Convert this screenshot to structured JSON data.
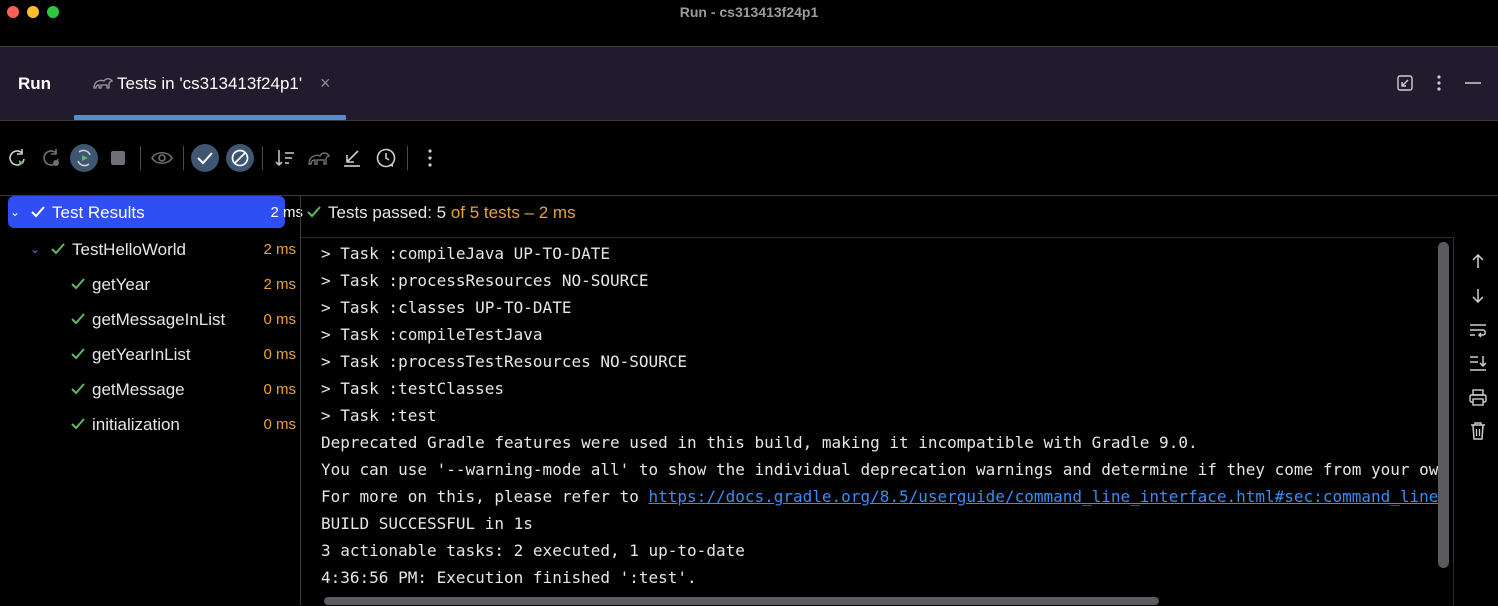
{
  "window": {
    "title": "Run - cs313413f24p1"
  },
  "tabbar": {
    "run_label": "Run",
    "tab_label": "Tests in 'cs313413f24p1'",
    "tab_close": "×",
    "right_icons": [
      "restore-layout-icon",
      "more-options-icon",
      "minimize-icon"
    ]
  },
  "toolbar": {
    "buttons": [
      "rerun-icon",
      "rerun-failed-icon",
      "toggle-auto-test-icon",
      "stop-icon",
      "show-ignored-icon",
      "show-passed-icon",
      "show-ignored-filter-icon",
      "sort-icon",
      "import-tests-icon",
      "export-icon",
      "history-icon",
      "more-icon"
    ],
    "active": [
      "toggle-auto-test-icon",
      "show-passed-icon",
      "show-ignored-filter-icon"
    ]
  },
  "tree": {
    "items": [
      {
        "name": "Test Results",
        "time": "2 ms",
        "level": 0,
        "expanded": true,
        "selected": true
      },
      {
        "name": "TestHelloWorld",
        "time": "2 ms",
        "level": 1,
        "expanded": true,
        "selected": false
      },
      {
        "name": "getYear",
        "time": "2 ms",
        "level": 2
      },
      {
        "name": "getMessageInList",
        "time": "0 ms",
        "level": 2
      },
      {
        "name": "getYearInList",
        "time": "0 ms",
        "level": 2
      },
      {
        "name": "getMessage",
        "time": "0 ms",
        "level": 2
      },
      {
        "name": "initialization",
        "time": "0 ms",
        "level": 2
      }
    ]
  },
  "status": {
    "passed": "Tests passed: 5",
    "rest": " of 5 tests – 2 ms"
  },
  "console": {
    "lines": [
      "> Task :compileJava UP-TO-DATE",
      "> Task :processResources NO-SOURCE",
      "> Task :classes UP-TO-DATE",
      "> Task :compileTestJava",
      "> Task :processTestResources NO-SOURCE",
      "> Task :testClasses",
      "> Task :test",
      "Deprecated Gradle features were used in this build, making it incompatible with Gradle 9.0.",
      "You can use '--warning-mode all' to show the individual deprecation warnings and determine if they come from your ow",
      "For more on this, please refer to ",
      "BUILD SUCCESSFUL in 1s",
      "3 actionable tasks: 2 executed, 1 up-to-date",
      "4:36:56 PM: Execution finished ':test'."
    ],
    "link": "https://docs.gradle.org/8.5/userguide/command_line_interface.html#sec:command_line"
  },
  "right_tools": [
    "scroll-up-icon",
    "scroll-down-icon",
    "soft-wrap-icon",
    "scroll-to-end-icon",
    "print-icon",
    "clear-icon"
  ],
  "colors": {
    "accent": "#2f4ef4",
    "pass": "#5fb865",
    "time": "#e8a33d",
    "link": "#3d8bf5"
  }
}
